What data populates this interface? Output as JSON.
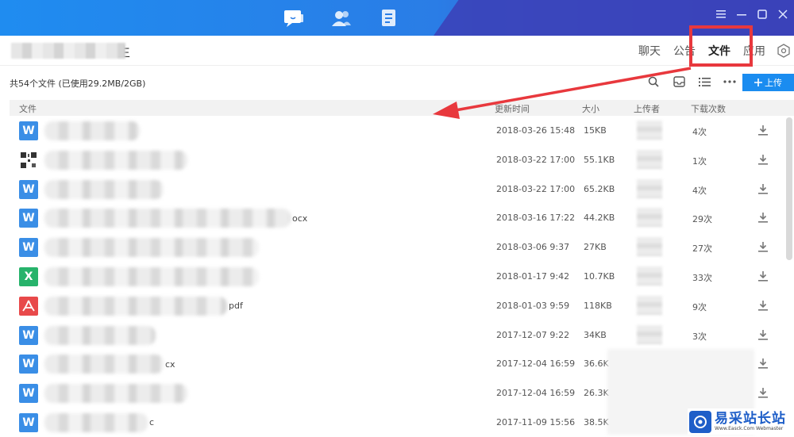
{
  "group": {
    "name_suffix": "生"
  },
  "tabs": [
    {
      "label": "聊天"
    },
    {
      "label": "公告"
    },
    {
      "label": "文件",
      "active": true
    },
    {
      "label": "应用"
    }
  ],
  "toolbar": {
    "summary": "共54个文件 (已使用29.2MB/2GB)",
    "upload_label": "上传",
    "upload_color": "#1a8cf0"
  },
  "columns": {
    "file": "文件",
    "time": "更新时间",
    "size": "大小",
    "uploader": "上传者",
    "downloads": "下载次数"
  },
  "files": [
    {
      "type": "word",
      "suffix": "",
      "time": "2018-03-26 15:48",
      "size": "15KB",
      "downloads": "4次"
    },
    {
      "type": "image",
      "suffix": "",
      "time": "2018-03-22 17:00",
      "size": "55.1KB",
      "downloads": "1次"
    },
    {
      "type": "word",
      "suffix": "",
      "time": "2018-03-22 17:00",
      "size": "65.2KB",
      "downloads": "4次"
    },
    {
      "type": "word",
      "suffix": "ocx",
      "time": "2018-03-16 17:22",
      "size": "44.2KB",
      "downloads": "29次"
    },
    {
      "type": "word",
      "suffix": "",
      "time": "2018-03-06 9:37",
      "size": "27KB",
      "downloads": "27次"
    },
    {
      "type": "excel",
      "suffix": "",
      "time": "2018-01-17 9:42",
      "size": "10.7KB",
      "downloads": "33次"
    },
    {
      "type": "pdf",
      "suffix": "pdf",
      "time": "2018-01-03 9:59",
      "size": "118KB",
      "downloads": "9次"
    },
    {
      "type": "word",
      "suffix": "",
      "time": "2017-12-07 9:22",
      "size": "34KB",
      "downloads": "3次"
    },
    {
      "type": "word",
      "suffix": "cx",
      "time": "2017-12-04 16:59",
      "size": "36.6K",
      "downloads": ""
    },
    {
      "type": "word",
      "suffix": "",
      "time": "2017-12-04 16:59",
      "size": "26.3K",
      "downloads": ""
    },
    {
      "type": "word",
      "suffix": "c",
      "time": "2017-11-09 15:56",
      "size": "38.5K",
      "downloads": ""
    }
  ],
  "watermark": {
    "cn": "易采站长站",
    "en": "Www.Easck.Com Webmaster"
  },
  "colors": {
    "word": "#3a8ee6",
    "excel": "#27b36b",
    "pdf": "#e8494a",
    "highlight": "#e8383d"
  }
}
